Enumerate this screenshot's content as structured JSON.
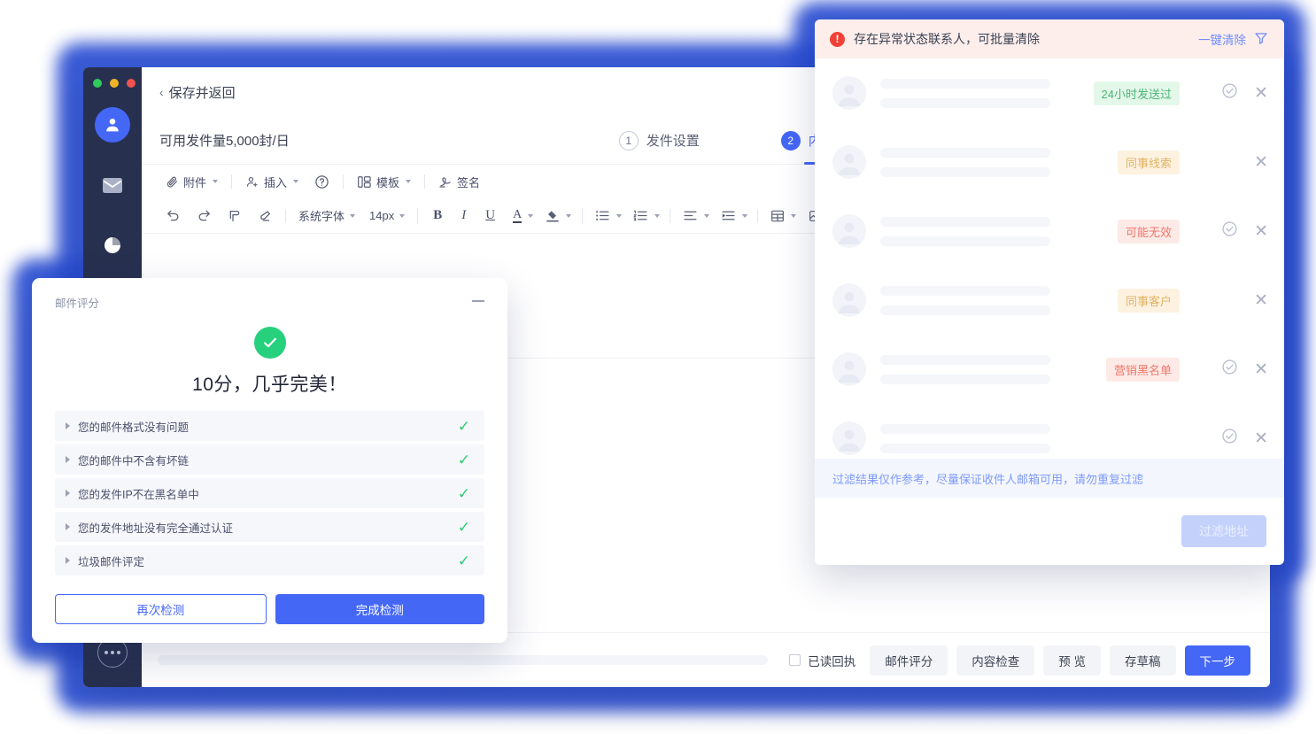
{
  "window": {
    "traffic_lights": [
      "green",
      "yellow",
      "red"
    ],
    "back_label": "保存并返回",
    "back_chevron": "chevron-left-icon",
    "quota_label": "可用发件量5,000封/日",
    "steps": [
      {
        "num": "1",
        "label": "发件设置",
        "active": false
      },
      {
        "num": "2",
        "label": "内容编辑",
        "active": true
      }
    ]
  },
  "sidebar": {
    "items": [
      {
        "icon": "user-avatar-icon",
        "name": "sidebar-item-contacts",
        "active": true
      },
      {
        "icon": "mail-icon",
        "name": "sidebar-item-mail",
        "active": false
      },
      {
        "icon": "pie-chart-icon",
        "name": "sidebar-item-stats",
        "active": false
      },
      {
        "icon": "chat-icon",
        "name": "sidebar-item-chat",
        "active": false
      }
    ],
    "more_label": "more-icon"
  },
  "toolbar_primary": [
    {
      "icon": "attachment-icon",
      "label": "附件",
      "caret": true
    },
    {
      "icon": "insert-person-icon",
      "label": "插入",
      "caret": true
    },
    {
      "icon": "help-icon",
      "label": "",
      "caret": false
    },
    {
      "icon": "template-icon",
      "label": "模板",
      "caret": true
    },
    {
      "icon": "signature-icon",
      "label": "签名",
      "caret": false
    }
  ],
  "toolbar_format": {
    "undo": "undo-icon",
    "redo": "redo-icon",
    "format_paint": "format-paint-icon",
    "clear_format": "clear-format-icon",
    "font_family": "系统字体",
    "font_size": "14px",
    "bold": "B",
    "italic": "I",
    "underline": "U",
    "text_color": "A",
    "highlight": "highlight-icon",
    "bullet_list": "bullet-list-icon",
    "numbered_list": "numbered-list-icon",
    "align": "align-left-icon",
    "indent": "indent-icon",
    "table": "table-icon",
    "image": "image-icon",
    "link": "link-icon"
  },
  "bottombar": {
    "read_receipt_label": "已读回执",
    "buttons": [
      {
        "label": "邮件评分",
        "primary": false
      },
      {
        "label": "内容检查",
        "primary": false
      },
      {
        "label": "预 览",
        "primary": false
      },
      {
        "label": "存草稿",
        "primary": false
      },
      {
        "label": "下一步",
        "primary": true
      }
    ]
  },
  "score_dialog": {
    "title": "邮件评分",
    "minimize_icon": "minimize-icon",
    "status_icon": "check-circle-icon",
    "score_text": "10分，几乎完美！",
    "items": [
      {
        "label": "您的邮件格式没有问题",
        "passed": true
      },
      {
        "label": "您的邮件中不含有坏链",
        "passed": true
      },
      {
        "label": "您的发件IP不在黑名单中",
        "passed": true
      },
      {
        "label": "您的发件地址没有完全通过认证",
        "passed": true
      },
      {
        "label": "垃圾邮件评定",
        "passed": true
      }
    ],
    "recheck_label": "再次检测",
    "finish_label": "完成检测"
  },
  "contacts_panel": {
    "warning": {
      "icon": "alert-icon",
      "text": "存在异常状态联系人，可批量清除",
      "action_label": "一键清除",
      "filter_icon": "filter-icon"
    },
    "rows": [
      {
        "avatar": "avatar-placeholder",
        "tag": "24小时发送过",
        "tag_color": "green",
        "has_check": true,
        "has_close": true
      },
      {
        "avatar": "avatar-placeholder",
        "tag": "同事线索",
        "tag_color": "orange",
        "has_check": false,
        "has_close": true
      },
      {
        "avatar": "avatar-placeholder",
        "tag": "可能无效",
        "tag_color": "red",
        "has_check": true,
        "has_close": true
      },
      {
        "avatar": "avatar-placeholder",
        "tag": "同事客户",
        "tag_color": "orange",
        "has_check": false,
        "has_close": true
      },
      {
        "avatar": "avatar-placeholder",
        "tag": "营销黑名单",
        "tag_color": "red",
        "has_check": true,
        "has_close": true
      },
      {
        "avatar": "avatar-placeholder",
        "tag": "",
        "tag_color": "",
        "has_check": true,
        "has_close": true
      }
    ],
    "tip": "过滤结果仅作参考，尽量保证收件人邮箱可用，请勿重复过滤",
    "filter_button_label": "过滤地址"
  },
  "colors": {
    "brand_blue": "#4467f6",
    "glow_blue": "#2b4fd4",
    "sidebar_dark": "#27304f",
    "success_green": "#26d07c",
    "warn_bg": "#fdeeec",
    "alert_red": "#ef4136"
  }
}
